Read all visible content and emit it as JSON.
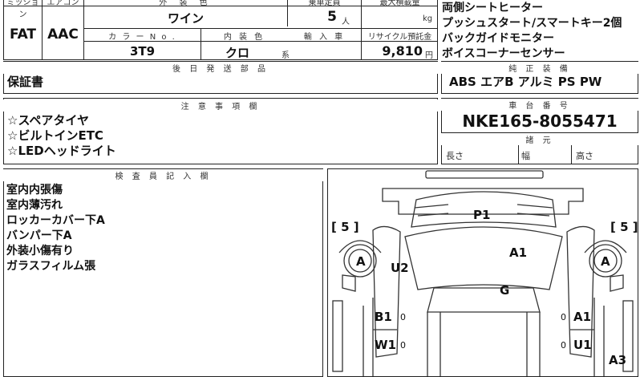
{
  "top": {
    "col_mission": "ミッション",
    "col_aircon": "エアコン",
    "mission": "FAT",
    "aircon": "AAC",
    "exterior_color_label": "外 装 色",
    "exterior_color": "ワイン",
    "capacity_label": "乗車定員",
    "capacity": "5",
    "capacity_unit": "人",
    "max_load_label": "最大積載量",
    "max_load_unit": "kg",
    "color_no_label": "カ ラ ー  N o .",
    "color_no": "3T9",
    "interior_color_label": "内 装 色",
    "interior_color": "クロ",
    "interior_suffix": "系",
    "import_label": "輸 入 車",
    "recycle_label": "リサイクル預託金",
    "recycle_amount": "9,810",
    "recycle_unit": "円"
  },
  "equipment_lines": [
    "両側シートヒーター",
    "プッシュスタート/スマートキー2個",
    "バックガイドモニター",
    "ボイスコーナーセンサー"
  ],
  "later_parts": {
    "header": "後 日 発 送 部 品",
    "value": "保証書"
  },
  "standard_equipment": {
    "header": "純 正 装 備",
    "value": "ABS エアB アルミ PS PW"
  },
  "notes": {
    "header": "注 意 事 項 欄",
    "lines": [
      "☆スペアタイヤ",
      "☆ビルトインETC",
      "☆LEDヘッドライト"
    ]
  },
  "chassis": {
    "header": "車 台 番 号",
    "number": "NKE165-8055471",
    "specs_header": "諸 元",
    "length_label": "長さ",
    "width_label": "幅",
    "height_label": "高さ"
  },
  "inspector": {
    "header": "検 査 員 記 入 欄",
    "lines": [
      "室内内張傷",
      "室内薄汚れ",
      "ロッカーカバー下A",
      "バンパー下A",
      "外装小傷有り",
      "ガラスフィルム張"
    ]
  },
  "diagram": {
    "left_tire": "[ 5 ]",
    "right_tire": "[ 5 ]",
    "left_wheel": "A",
    "right_wheel": "A",
    "marks": {
      "p1": "P1",
      "a1_top": "A1",
      "u2": "U2",
      "g": "G",
      "b1": "B1",
      "a1_right": "A1",
      "w1": "W1",
      "u1": "U1",
      "a3": "A3",
      "zero_left_1": "0",
      "zero_left_2": "0",
      "zero_right_1": "0",
      "zero_right_2": "0"
    }
  }
}
